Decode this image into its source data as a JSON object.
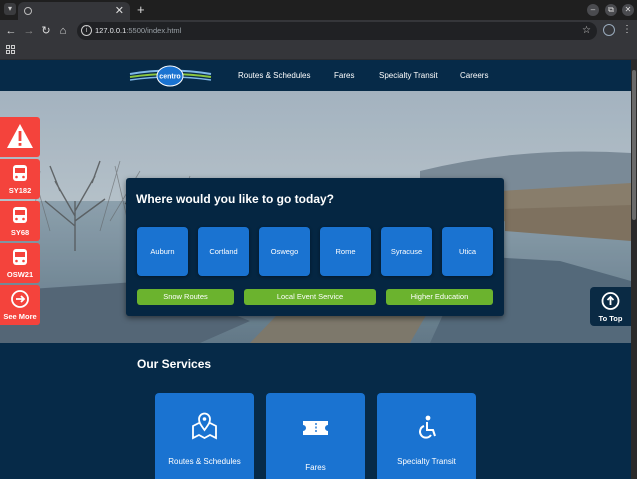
{
  "browser": {
    "url_host": "127.0.0.1",
    "url_path": ":5500/index.html"
  },
  "site": {
    "logo_text": "centro",
    "nav": [
      "Routes & Schedules",
      "Fares",
      "Specialty Transit",
      "Careers"
    ]
  },
  "hero": {
    "card_title": "Where would you like to go today?",
    "cities": [
      "Auburn",
      "Cortland",
      "Oswego",
      "Rome",
      "Syracuse",
      "Utica"
    ],
    "pills": [
      "Snow Routes",
      "Local Event Service",
      "Higher Education"
    ]
  },
  "side_buttons": [
    {
      "icon": "warning-icon",
      "label": ""
    },
    {
      "icon": "bus-icon",
      "label": "SY182"
    },
    {
      "icon": "bus-icon",
      "label": "SY68"
    },
    {
      "icon": "bus-icon",
      "label": "OSW21"
    },
    {
      "icon": "arrow-right-circle-icon",
      "label": "See More"
    }
  ],
  "to_top": {
    "icon": "arrow-up-circle-icon",
    "label": "To Top"
  },
  "services": {
    "title": "Our Services",
    "items": [
      {
        "icon": "map-pin-icon",
        "label": "Routes & Schedules"
      },
      {
        "icon": "ticket-icon",
        "label": "Fares"
      },
      {
        "icon": "wheelchair-icon",
        "label": "Specialty Transit"
      }
    ]
  },
  "colors": {
    "navy": "#062a48",
    "blue": "#1a73d1",
    "green": "#6bb32e",
    "red": "#f4433c"
  }
}
